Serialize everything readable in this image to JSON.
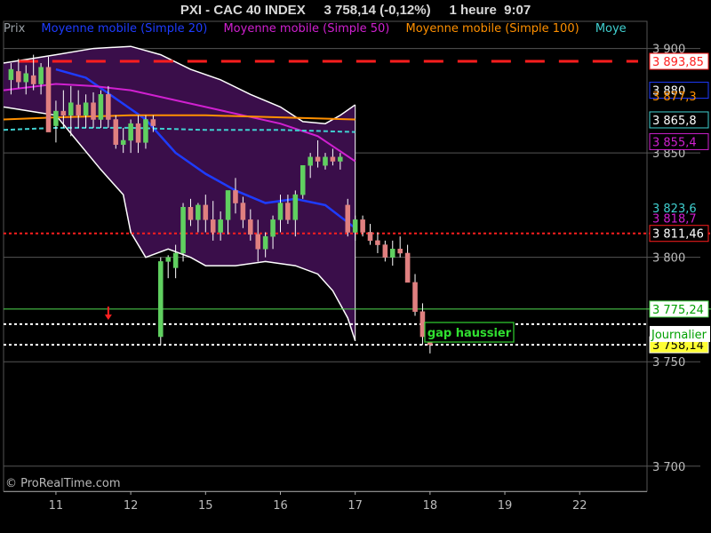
{
  "title": "PXI - CAC 40 INDEX     3 758,14 (-0,12%)     1 heure  9:07",
  "legend": [
    {
      "text": "Prix",
      "color": "#9aa0a6"
    },
    {
      "text": "Moyenne mobile (Simple 20)",
      "color": "#1e3cff"
    },
    {
      "text": "Moyenne mobile (Simple 50)",
      "color": "#d020d0"
    },
    {
      "text": "Moyenne mobile (Simple 100)",
      "color": "#ff9000"
    },
    {
      "text": "Moye",
      "color": "#40d0d0"
    }
  ],
  "watermark": "© ProRealTime.com",
  "annotation": "gap haussier",
  "chart_data": {
    "type": "candlestick",
    "y_range": [
      3688,
      3913
    ],
    "y_ticks": [
      {
        "label": "3 900",
        "value": 3900
      },
      {
        "label": "3 850",
        "value": 3850
      },
      {
        "label": "3 800",
        "value": 3800
      },
      {
        "label": "3 750",
        "value": 3750
      },
      {
        "label": "3 700",
        "value": 3700
      }
    ],
    "x_axis": {
      "index_range": [
        -7,
        79
      ],
      "ticks": [
        {
          "label": "11",
          "index": 0
        },
        {
          "label": "12",
          "index": 10
        },
        {
          "label": "15",
          "index": 20
        },
        {
          "label": "16",
          "index": 30
        },
        {
          "label": "17",
          "index": 40
        },
        {
          "label": "18",
          "index": 50
        },
        {
          "label": "19",
          "index": 60
        },
        {
          "label": "22",
          "index": 70
        }
      ]
    },
    "candles": [
      {
        "o": 3885,
        "h": 3893,
        "l": 3878,
        "c": 3890
      },
      {
        "o": 3889,
        "h": 3895,
        "l": 3881,
        "c": 3884
      },
      {
        "o": 3884,
        "h": 3892,
        "l": 3878,
        "c": 3888
      },
      {
        "o": 3887,
        "h": 3897,
        "l": 3880,
        "c": 3883
      },
      {
        "o": 3883,
        "h": 3893,
        "l": 3878,
        "c": 3891
      },
      {
        "o": 3891,
        "h": 3896,
        "l": 3873,
        "c": 3860
      },
      {
        "o": 3863,
        "h": 3875,
        "l": 3855,
        "c": 3870
      },
      {
        "o": 3870,
        "h": 3880,
        "l": 3862,
        "c": 3868
      },
      {
        "o": 3868,
        "h": 3882,
        "l": 3858,
        "c": 3874
      },
      {
        "o": 3873,
        "h": 3880,
        "l": 3862,
        "c": 3868
      },
      {
        "o": 3868,
        "h": 3878,
        "l": 3862,
        "c": 3874
      },
      {
        "o": 3874,
        "h": 3879,
        "l": 3862,
        "c": 3866
      },
      {
        "o": 3866,
        "h": 3880,
        "l": 3862,
        "c": 3878
      },
      {
        "o": 3878,
        "h": 3882,
        "l": 3862,
        "c": 3866
      },
      {
        "o": 3866,
        "h": 3868,
        "l": 3852,
        "c": 3854
      },
      {
        "o": 3854,
        "h": 3862,
        "l": 3850,
        "c": 3856
      },
      {
        "o": 3856,
        "h": 3866,
        "l": 3850,
        "c": 3864
      },
      {
        "o": 3864,
        "h": 3868,
        "l": 3850,
        "c": 3855
      },
      {
        "o": 3855,
        "h": 3868,
        "l": 3852,
        "c": 3866
      },
      {
        "o": 3866,
        "h": 3868,
        "l": 3860,
        "c": 3863
      },
      {
        "o": 3762,
        "h": 3800,
        "l": 3758,
        "c": 3798
      },
      {
        "o": 3798,
        "h": 3801,
        "l": 3790,
        "c": 3800
      },
      {
        "o": 3795,
        "h": 3806,
        "l": 3790,
        "c": 3802
      },
      {
        "o": 3802,
        "h": 3826,
        "l": 3798,
        "c": 3824
      },
      {
        "o": 3824,
        "h": 3828,
        "l": 3815,
        "c": 3818
      },
      {
        "o": 3818,
        "h": 3826,
        "l": 3812,
        "c": 3825
      },
      {
        "o": 3825,
        "h": 3830,
        "l": 3812,
        "c": 3818
      },
      {
        "o": 3818,
        "h": 3827,
        "l": 3808,
        "c": 3812
      },
      {
        "o": 3812,
        "h": 3822,
        "l": 3808,
        "c": 3818
      },
      {
        "o": 3818,
        "h": 3826,
        "l": 3811,
        "c": 3832
      },
      {
        "o": 3832,
        "h": 3838,
        "l": 3821,
        "c": 3826
      },
      {
        "o": 3826,
        "h": 3829,
        "l": 3814,
        "c": 3818
      },
      {
        "o": 3818,
        "h": 3823,
        "l": 3808,
        "c": 3811
      },
      {
        "o": 3811,
        "h": 3818,
        "l": 3798,
        "c": 3804
      },
      {
        "o": 3804,
        "h": 3812,
        "l": 3800,
        "c": 3810
      },
      {
        "o": 3810,
        "h": 3820,
        "l": 3804,
        "c": 3818
      },
      {
        "o": 3818,
        "h": 3830,
        "l": 3812,
        "c": 3826
      },
      {
        "o": 3826,
        "h": 3830,
        "l": 3816,
        "c": 3818
      },
      {
        "o": 3818,
        "h": 3832,
        "l": 3810,
        "c": 3830
      },
      {
        "o": 3830,
        "h": 3843,
        "l": 3828,
        "c": 3844
      },
      {
        "o": 3844,
        "h": 3850,
        "l": 3838,
        "c": 3848
      },
      {
        "o": 3848,
        "h": 3856,
        "l": 3843,
        "c": 3846
      },
      {
        "o": 3844,
        "h": 3850,
        "l": 3842,
        "c": 3848
      },
      {
        "o": 3848,
        "h": 3852,
        "l": 3844,
        "c": 3846
      },
      {
        "o": 3846,
        "h": 3850,
        "l": 3842,
        "c": 3848
      },
      {
        "o": 3825,
        "h": 3828,
        "l": 3810,
        "c": 3812
      },
      {
        "o": 3812,
        "h": 3820,
        "l": 3808,
        "c": 3818
      },
      {
        "o": 3818,
        "h": 3820,
        "l": 3810,
        "c": 3812
      },
      {
        "o": 3812,
        "h": 3816,
        "l": 3806,
        "c": 3808
      },
      {
        "o": 3808,
        "h": 3812,
        "l": 3802,
        "c": 3806
      },
      {
        "o": 3806,
        "h": 3808,
        "l": 3798,
        "c": 3800
      },
      {
        "o": 3800,
        "h": 3808,
        "l": 3796,
        "c": 3804
      },
      {
        "o": 3804,
        "h": 3810,
        "l": 3800,
        "c": 3802
      },
      {
        "o": 3802,
        "h": 3806,
        "l": 3790,
        "c": 3788
      },
      {
        "o": 3788,
        "h": 3792,
        "l": 3772,
        "c": 3774
      },
      {
        "o": 3774,
        "h": 3778,
        "l": 3758,
        "c": 3762
      },
      {
        "o": 3762,
        "h": 3764,
        "l": 3754,
        "c": 3758.14
      }
    ],
    "series": [
      {
        "name": "Moyenne mobile (Simple 20)",
        "color": "#1e3cff",
        "points": [
          [
            0,
            3890
          ],
          [
            4,
            3886
          ],
          [
            8,
            3876
          ],
          [
            12,
            3866
          ],
          [
            16,
            3850
          ],
          [
            20,
            3840
          ],
          [
            24,
            3832
          ],
          [
            28,
            3826
          ],
          [
            32,
            3828
          ],
          [
            36,
            3825
          ],
          [
            40,
            3814
          ]
        ]
      },
      {
        "name": "Moyenne mobile (Simple 50)",
        "color": "#d020d0",
        "points": [
          [
            -7,
            3880
          ],
          [
            0,
            3883
          ],
          [
            5,
            3882
          ],
          [
            10,
            3880
          ],
          [
            15,
            3876
          ],
          [
            20,
            3872
          ],
          [
            25,
            3868
          ],
          [
            30,
            3864
          ],
          [
            35,
            3858
          ],
          [
            40,
            3846
          ]
        ]
      },
      {
        "name": "Moyenne mobile (Simple 100)",
        "color": "#ff9000",
        "points": [
          [
            -7,
            3866
          ],
          [
            0,
            3867
          ],
          [
            10,
            3868
          ],
          [
            20,
            3868
          ],
          [
            30,
            3867
          ],
          [
            40,
            3866
          ]
        ]
      },
      {
        "name": "Moye",
        "color": "#40d0d0",
        "points": [
          [
            -7,
            3861
          ],
          [
            0,
            3862
          ],
          [
            10,
            3862
          ],
          [
            20,
            3861
          ],
          [
            30,
            3861
          ],
          [
            40,
            3860
          ]
        ]
      }
    ],
    "bollinger": {
      "upper": [
        [
          -7,
          3893
        ],
        [
          0,
          3897
        ],
        [
          5,
          3900
        ],
        [
          10,
          3901
        ],
        [
          14,
          3897
        ],
        [
          18,
          3890
        ],
        [
          22,
          3885
        ],
        [
          26,
          3878
        ],
        [
          30,
          3872
        ],
        [
          33,
          3865
        ],
        [
          36,
          3864
        ],
        [
          38,
          3868
        ],
        [
          40,
          3873
        ]
      ],
      "lower": [
        [
          -7,
          3872
        ],
        [
          0,
          3868
        ],
        [
          3,
          3855
        ],
        [
          6,
          3842
        ],
        [
          9,
          3830
        ],
        [
          10,
          3812
        ],
        [
          12,
          3800
        ],
        [
          15,
          3804
        ],
        [
          18,
          3800
        ],
        [
          20,
          3796
        ],
        [
          24,
          3796
        ],
        [
          28,
          3798
        ],
        [
          32,
          3796
        ],
        [
          35,
          3792
        ],
        [
          37,
          3784
        ],
        [
          39,
          3771
        ],
        [
          40,
          3760
        ]
      ],
      "fill": "#3a0e4a"
    },
    "levels": [
      {
        "value": 3893.85,
        "label": "3 893,85",
        "style": "dash",
        "color": "#ff1e1e",
        "box_bg": "#ffffff",
        "box_fg": "#ff1e1e",
        "x_start": -5
      },
      {
        "value": 3880,
        "label": "3 880",
        "style": "none",
        "color": "#1e3cff",
        "box_bg": "#000000",
        "box_fg": "#ffffff",
        "x_start": 0
      },
      {
        "value": 3865.8,
        "label": "3 865,8",
        "style": "none",
        "color": "#40d0d0",
        "box_bg": "#000000",
        "box_fg": "#ffffff",
        "x_start": 0
      },
      {
        "value": 3855.4,
        "label": "3 855,4",
        "style": "none",
        "color": "#d020d0",
        "box_bg": "#000000",
        "box_fg": "#d020d0",
        "x_start": 0
      },
      {
        "value": 3811.46,
        "label": "3 811,46",
        "style": "dot",
        "color": "#ff1e1e",
        "box_bg": "#000000",
        "box_fg": "#ffffff",
        "x_start": -7
      },
      {
        "value": 3775.24,
        "label": "3 775,24",
        "style": "solid",
        "color": "#50dc50",
        "box_bg": "#ffffff",
        "box_fg": "#00a000",
        "x_start": -7
      },
      {
        "value": 3768,
        "label": "",
        "style": "whitedot",
        "color": "#ffffff",
        "box_bg": "",
        "box_fg": "",
        "x_start": -7
      },
      {
        "value": 3758.14,
        "label": "3 758,14",
        "style": "whitedot",
        "color": "#ffffff",
        "box_bg": "#ffff33",
        "box_fg": "#000000",
        "x_start": -7
      }
    ],
    "secondary_label": {
      "text": "Journalier",
      "value": 3765
    },
    "partial_labels": [
      {
        "text": "3 818,7",
        "value": 3818.7,
        "color": "#d020d0"
      },
      {
        "text": "3 823,6",
        "value": 3823.6,
        "color": "#40d0d0"
      },
      {
        "text": "3 877,3",
        "value": 3877.3,
        "color": "#ff9000"
      }
    ],
    "arrow": {
      "index": 7,
      "value": 3773
    },
    "annotation_box": {
      "index": 57,
      "value": 3762
    }
  }
}
